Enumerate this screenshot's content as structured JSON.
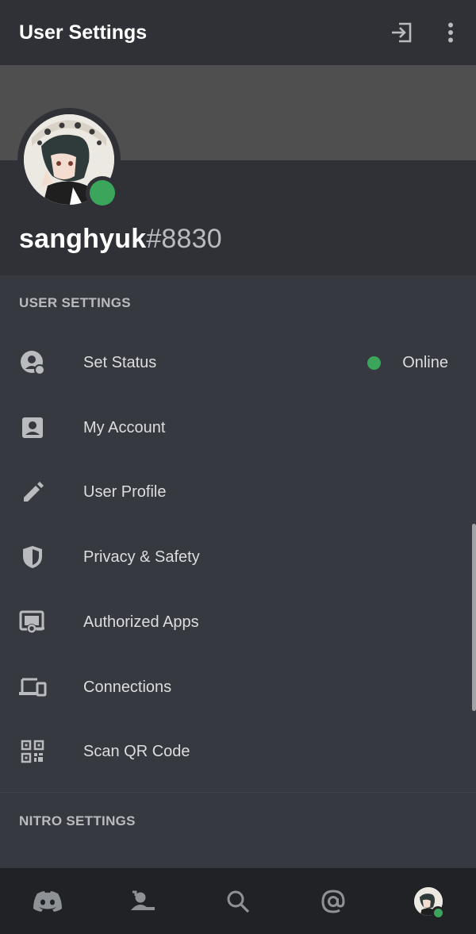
{
  "header": {
    "title": "User Settings",
    "logout_icon": "logout-icon",
    "more_icon": "more-vertical-icon"
  },
  "profile": {
    "username": "sanghyuk",
    "discriminator": "#8830",
    "status_color": "#3ba55c"
  },
  "sections": {
    "user_settings": "USER SETTINGS",
    "nitro_settings": "NITRO SETTINGS"
  },
  "menu": [
    {
      "label": "Set Status",
      "icon": "status-icon",
      "value": "Online"
    },
    {
      "label": "My Account",
      "icon": "account-icon"
    },
    {
      "label": "User Profile",
      "icon": "pencil-icon"
    },
    {
      "label": "Privacy & Safety",
      "icon": "shield-icon"
    },
    {
      "label": "Authorized Apps",
      "icon": "authorized-apps-icon"
    },
    {
      "label": "Connections",
      "icon": "devices-icon"
    },
    {
      "label": "Scan QR Code",
      "icon": "qr-code-icon"
    }
  ],
  "bottom_nav": [
    {
      "icon": "discord-home-icon"
    },
    {
      "icon": "friends-icon"
    },
    {
      "icon": "search-icon"
    },
    {
      "icon": "mentions-icon"
    },
    {
      "icon": "user-avatar"
    }
  ],
  "colors": {
    "background": "#36393f",
    "header": "#2f3136",
    "banner": "#4f4f4f",
    "nav": "#202225",
    "online": "#3ba55c"
  }
}
